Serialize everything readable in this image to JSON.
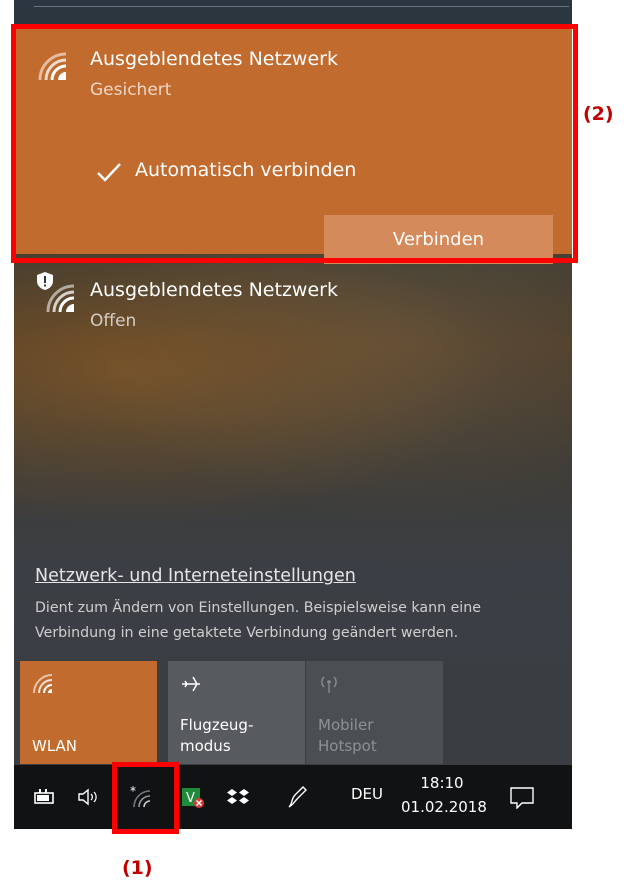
{
  "networks": [
    {
      "name": "Ausgeblendetes Netzwerk",
      "status": "Gesichert",
      "auto_connect_label": "Automatisch verbinden",
      "auto_connect_checked": true,
      "connect_label": "Verbinden",
      "icon": "wifi-icon"
    },
    {
      "name": "Ausgeblendetes Netzwerk",
      "status": "Offen",
      "icon": "wifi-unsecured-icon"
    }
  ],
  "settings": {
    "link": "Netzwerk- und Interneteinstellungen",
    "description": "Dient zum Ändern von Einstellungen. Beispielsweise kann eine Verbindung in eine getaktete Verbindung geändert werden."
  },
  "quick_actions": [
    {
      "label": "WLAN",
      "icon": "wifi-icon",
      "active": true
    },
    {
      "label_line1": "Flugzeug-",
      "label_line2": "modus",
      "icon": "airplane-icon",
      "active": false
    },
    {
      "label_line1": "Mobiler",
      "label_line2": "Hotspot",
      "icon": "hotspot-icon",
      "active": false,
      "disabled": true
    }
  ],
  "taskbar": {
    "language": "DEU",
    "time": "18:10",
    "date": "01.02.2018"
  },
  "annotations": {
    "one": "(1)",
    "two": "(2)"
  },
  "colors": {
    "accent": "#c26b2f",
    "annotation": "#ff0000"
  }
}
